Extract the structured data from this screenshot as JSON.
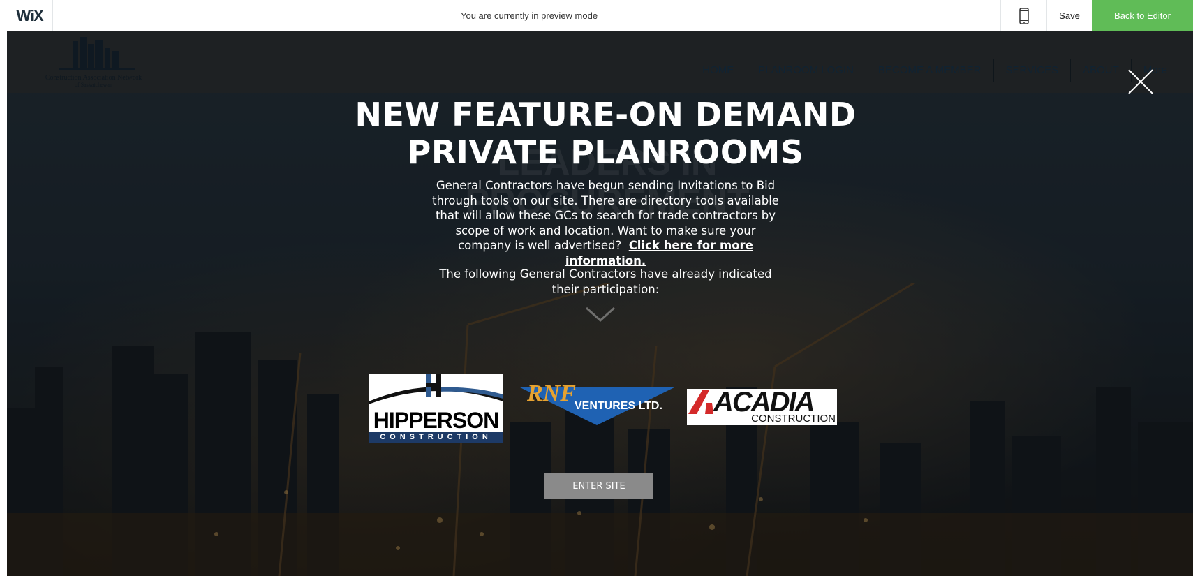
{
  "wix_bar": {
    "logo": "WiX",
    "preview_message": "You are currently in preview mode",
    "mobile_icon": "mobile-phone-icon",
    "save_label": "Save",
    "back_label": "Back to Editor",
    "accent": "#60bc57"
  },
  "site": {
    "logo_line1": "Construction Association Network",
    "logo_line2": "of Saskatchewan",
    "nav": [
      "HOME",
      "PLANROOM LOGIN",
      "BECOME A MEMBER",
      "SERVICES",
      "ABOUT",
      "More"
    ],
    "background_heading": "LEADERS IN PROCUREMENT"
  },
  "popup": {
    "title_line1": "NEW FEATURE-ON DEMAND",
    "title_line2": "PRIVATE PLANROOMS",
    "body": "General Contractors have begun sending Invitations to Bid through tools on our site.  There are directory tools available that will allow these GCs to search for trade contractors by scope of work and location.  Want to make sure your company is well advertised?",
    "link_text": "Click here for more information.",
    "note": "The following General Contractors have already indicated their participation:",
    "logos": {
      "hipperson_top": "HIPPERSON",
      "hipperson_bottom": "CONSTRUCTION",
      "rnf_mark": "RNF",
      "rnf_text": "VENTURES LTD.",
      "acadia_top": "ACADIA",
      "acadia_bottom": "CONSTRUCTION"
    },
    "enter_label": "ENTER SITE",
    "close_icon": "close-icon"
  }
}
